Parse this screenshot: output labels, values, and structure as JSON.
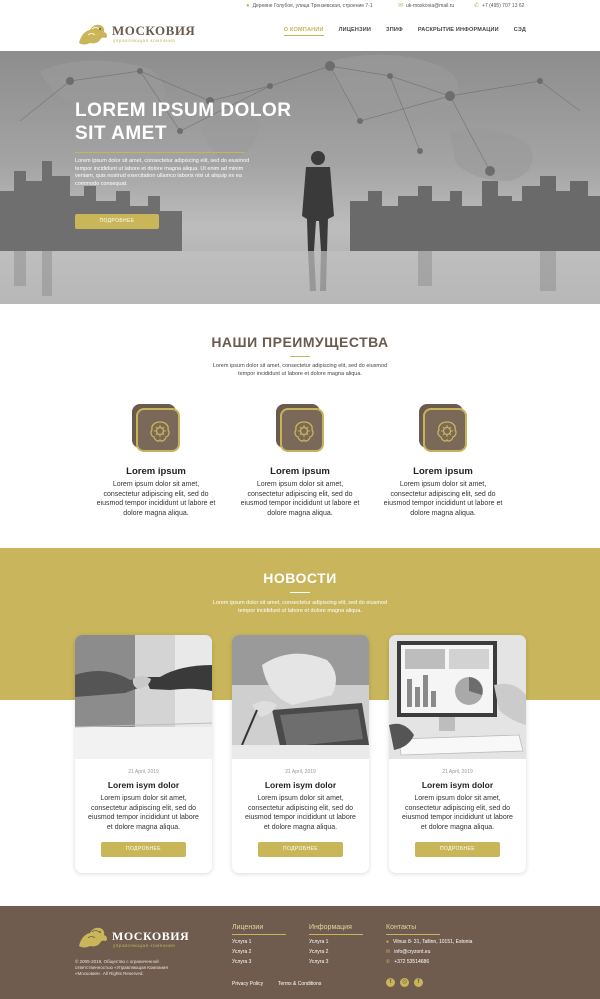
{
  "topbar": {
    "address": "Деревне Голубое, улица Трензевская, строение 7-1",
    "email": "uk-moskovia@mail.ru",
    "phone": "+7 (495) 707 13 62"
  },
  "logo": {
    "name": "МОСКОВИЯ",
    "subtitle": "управляющая компания"
  },
  "nav": [
    {
      "label": "О КОМПАНИИ",
      "active": true
    },
    {
      "label": "ЛИЦЕНЗИИ"
    },
    {
      "label": "ЗПИФ"
    },
    {
      "label": "РАСКРЫТИЕ ИНФОРМАЦИИ"
    },
    {
      "label": "СЭД"
    }
  ],
  "hero": {
    "title": "LOREM IPSUM DOLOR SIT AMET",
    "text": "Lorem ipsum dolor sit amet, consectetur adipiscing elit, sed do eiusmod tempor incididunt ut labore et dolore magna aliqua. Ut enim ad minim veniam, quis nostrud exercitation ullamco laboris nisi ut aliquip ex ea commodo consequat.",
    "button": "ПОДРОБНЕЕ"
  },
  "advantages": {
    "title": "НАШИ ПРЕИМУЩЕСТВА",
    "intro": "Lorem ipsum dolor sit amet, consectetur adipiscing elit, sed do eiusmod tempor incididunt ut labore et dolore magna aliqua.",
    "items": [
      {
        "title": "Lorem ipsum",
        "text": "Lorem ipsum dolor sit amet, consectetur adipiscing elit, sed do eiusmod tempor incididunt ut labore et dolore magna aliqua."
      },
      {
        "title": "Lorem ipsum",
        "text": "Lorem ipsum dolor sit amet, consectetur adipiscing elit, sed do eiusmod tempor incididunt ut labore et dolore magna aliqua."
      },
      {
        "title": "Lorem ipsum",
        "text": "Lorem ipsum dolor sit amet, consectetur adipiscing elit, sed do eiusmod tempor incididunt ut labore et dolore magna aliqua."
      }
    ]
  },
  "news": {
    "title": "НОВОСТИ",
    "intro": "Lorem ipsum dolor sit amet, consectetur adipiscing elit, sed do eiusmod tempor incididunt ut labore et dolore magna aliqua.",
    "items": [
      {
        "date": "21 April, 2019",
        "title": "Lorem isym dolor",
        "text": "Lorem ipsum dolor sit amet, consectetur adipiscing elit, sed do eiusmod tempor incididunt ut labore et dolore magna aliqua.",
        "button": "ПОДРОБНЕЕ"
      },
      {
        "date": "21 April, 2019",
        "title": "Lorem isym dolor",
        "text": "Lorem ipsum dolor sit amet, consectetur adipiscing elit, sed do eiusmod tempor incididunt ut labore et dolore magna aliqua.",
        "button": "ПОДРОБНЕЕ"
      },
      {
        "date": "21 April, 2019",
        "title": "Lorem isym dolor",
        "text": "Lorem ipsum dolor sit amet, consectetur adipiscing elit, sed do eiusmod tempor incididunt ut labore et dolore magna aliqua.",
        "button": "ПОДРОБНЕЕ"
      }
    ]
  },
  "footer": {
    "logo_name": "МОСКОВИЯ",
    "logo_subtitle": "управляющая компания",
    "copyright": "© 2005-2019, Общество с ограниченной ответственностью «Управляющая Компания «Московия». All Rights Reserved.",
    "licenses": {
      "title": "Лицензии",
      "items": [
        "Услуга 1",
        "Услуга 2",
        "Услуга 3"
      ]
    },
    "info": {
      "title": "Информация",
      "items": [
        "Услуга 1",
        "Услуга 2",
        "Услуга 3"
      ]
    },
    "contacts": {
      "title": "Контакты",
      "address": "Vilnus 8- 31, Tallinn, 10151, Estonia",
      "email": "info@cryzont.eu",
      "phone": "+372 53514686"
    },
    "privacy": "Privacy Policy",
    "terms": "Terms & Conditions"
  },
  "colors": {
    "gold": "#c9b658",
    "brown": "#6f5c4f"
  },
  "icons": [
    "map-pin-icon",
    "mail-icon",
    "phone-icon",
    "lion-logo-icon",
    "brain-gear-icon",
    "twitter-icon",
    "instagram-icon",
    "facebook-icon"
  ]
}
